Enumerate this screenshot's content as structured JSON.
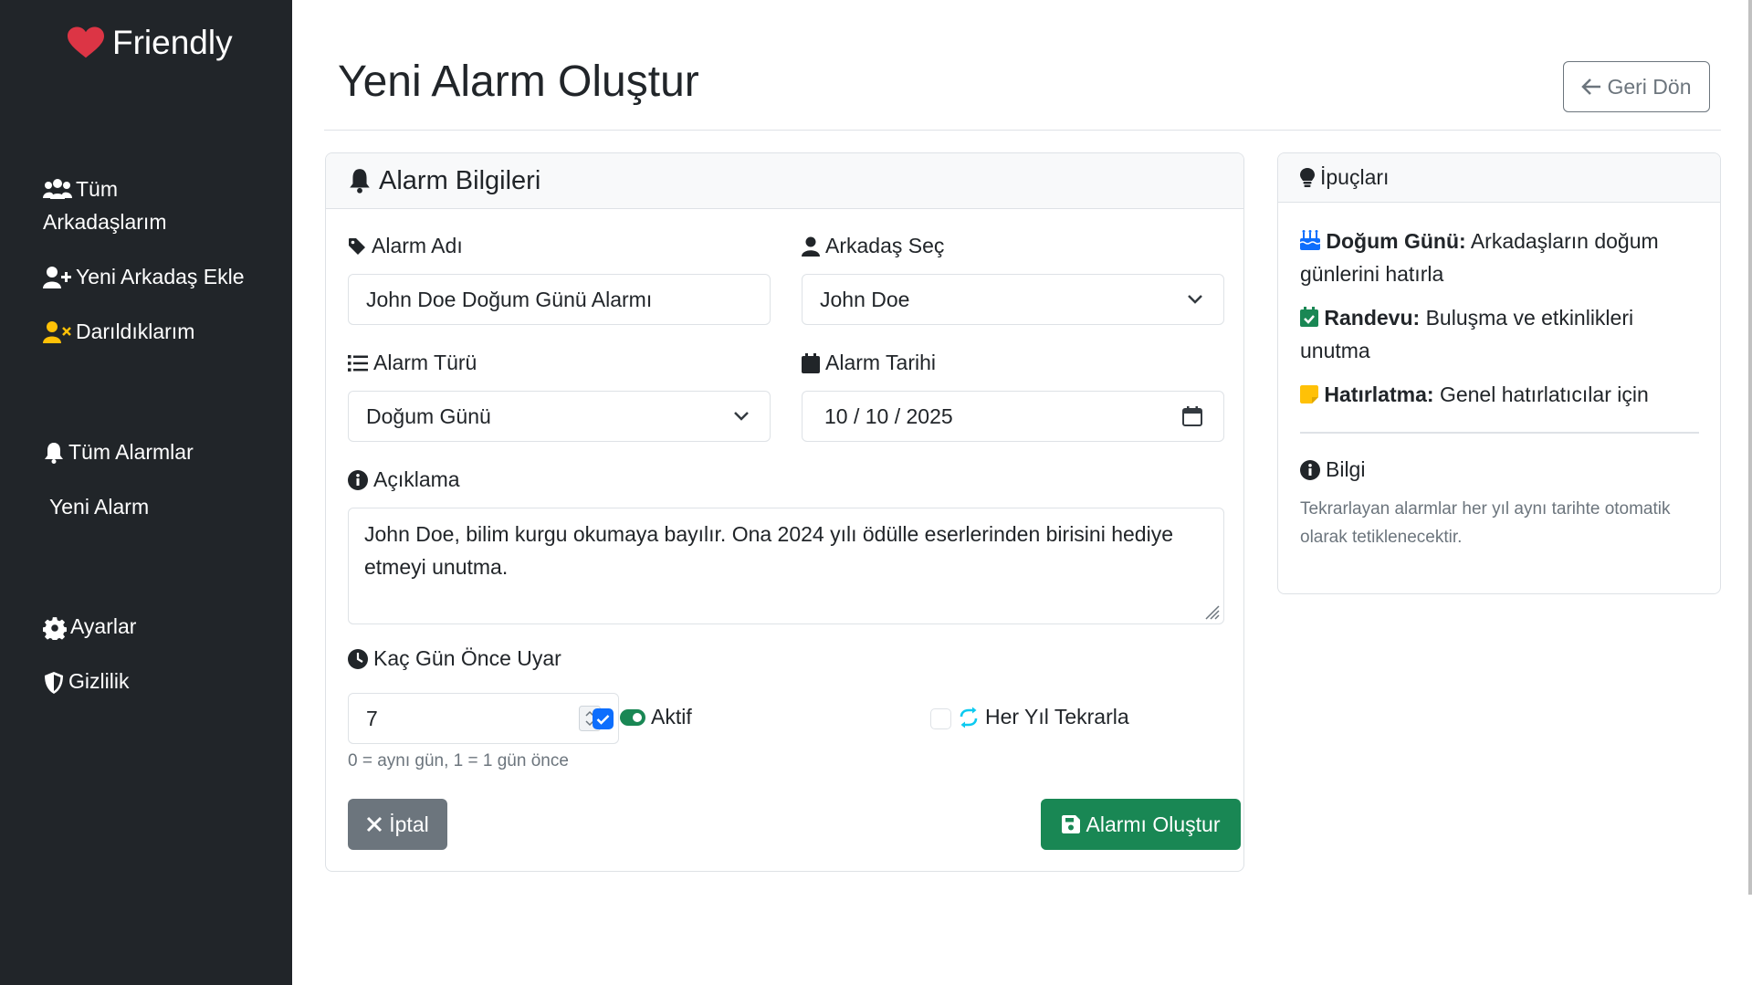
{
  "sidebar": {
    "brand": "Friendly",
    "items": [
      {
        "label_line1": "Tüm",
        "label_line2": "Arkadaşlarım"
      },
      {
        "label": "Yeni Arkadaş Ekle"
      },
      {
        "label": "Darıldıklarım"
      },
      {
        "label": "Tüm Alarmlar"
      },
      {
        "label": "Yeni Alarm"
      },
      {
        "label": "Ayarlar"
      },
      {
        "label": "Gizlilik"
      }
    ]
  },
  "header": {
    "title": "Yeni Alarm Oluştur",
    "back_label": "Geri Dön"
  },
  "form": {
    "card_title": "Alarm Bilgileri",
    "alarm_name": {
      "label": "Alarm Adı",
      "value": "John Doe Doğum Günü Alarmı"
    },
    "friend": {
      "label": "Arkadaş Seç",
      "value": "John Doe"
    },
    "alarm_type": {
      "label": "Alarm Türü",
      "value": "Doğum Günü"
    },
    "alarm_date": {
      "label": "Alarm Tarihi",
      "value": "10 / 10 / 2025"
    },
    "description": {
      "label": "Açıklama",
      "value": "John Doe, bilim kurgu okumaya bayılır. Ona 2024 yılı ödülle eserlerinden birisini hediye etmeyi unutma."
    },
    "days_before": {
      "label": "Kaç Gün Önce Uyar",
      "value": "7",
      "hint": "0 = aynı gün, 1 = 1 gün önce"
    },
    "active": {
      "label": "Aktif",
      "checked": true
    },
    "repeat": {
      "label": "Her Yıl Tekrarla",
      "checked": false
    },
    "cancel_label": "İptal",
    "submit_label": "Alarmı Oluştur"
  },
  "tips": {
    "title": "İpuçları",
    "items": [
      {
        "title": "Doğum Günü:",
        "text": "Arkadaşların doğum günlerini hatırla"
      },
      {
        "title": "Randevu:",
        "text": "Buluşma ve etkinlikleri unutma"
      },
      {
        "title": "Hatırlatma:",
        "text": "Genel hatırlatıcılar için"
      }
    ],
    "info_title": "Bilgi",
    "info_text": "Tekrarlayan alarmlar her yıl aynı tarihte otomatik olarak tetiklenecektir."
  },
  "colors": {
    "sidebar_bg": "#212529",
    "heart": "#dc3545",
    "success": "#198754",
    "primary": "#0d6efd",
    "secondary": "#6c757d",
    "warning": "#ffc107",
    "info": "#0dcaf0"
  },
  "icons": [
    "heart-icon",
    "users-icon",
    "user-plus-icon",
    "user-x-icon",
    "bell-icon",
    "gear-icon",
    "shield-icon",
    "arrow-left-icon",
    "tag-icon",
    "user-icon",
    "list-icon",
    "calendar-icon",
    "info-icon",
    "clock-icon",
    "toggle-icon",
    "repeat-icon",
    "x-icon",
    "save-icon",
    "lightbulb-icon",
    "cake-icon",
    "calendar-check-icon",
    "sticky-note-icon"
  ]
}
